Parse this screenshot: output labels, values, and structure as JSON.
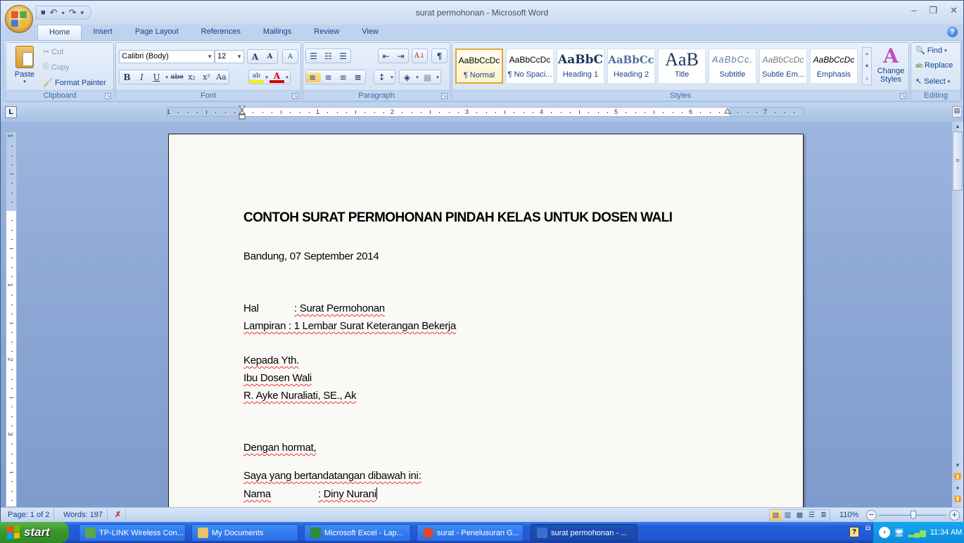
{
  "window": {
    "title": "surat permohonan - Microsoft Word",
    "controls": {
      "minimize": "–",
      "restore": "❐",
      "close": "✕"
    }
  },
  "quick_access": {
    "save": "💾",
    "undo": "↶",
    "redo": "↷",
    "customize": "▾"
  },
  "tabs": [
    {
      "label": "Home",
      "active": true
    },
    {
      "label": "Insert"
    },
    {
      "label": "Page Layout"
    },
    {
      "label": "References"
    },
    {
      "label": "Mailings"
    },
    {
      "label": "Review"
    },
    {
      "label": "View"
    }
  ],
  "help_icon": "?",
  "ribbon": {
    "clipboard": {
      "label": "Clipboard",
      "paste": "Paste",
      "cut": "Cut",
      "copy": "Copy",
      "format_painter": "Format Painter"
    },
    "font": {
      "label": "Font",
      "font_name": "Calibri (Body)",
      "font_size": "12",
      "grow": "A",
      "shrink": "A",
      "clear": "A",
      "bold": "B",
      "italic": "I",
      "underline": "U",
      "strike": "abe",
      "subscript": "x₂",
      "superscript": "x²",
      "change_case": "Aa",
      "highlight": "ab",
      "font_color": "A",
      "highlight_color": "#f5f000",
      "font_color_value": "#d40000"
    },
    "paragraph": {
      "label": "Paragraph",
      "bullets": "☰",
      "numbering": "☷",
      "multilevel": "☰",
      "decrease_indent": "⇤",
      "increase_indent": "⇥",
      "sort": "A↓",
      "show_marks": "¶",
      "align_left": "≡",
      "center": "≡",
      "align_right": "≡",
      "justify": "≡",
      "line_spacing": "↕",
      "shading": "◈",
      "borders": "▦"
    },
    "styles": {
      "label": "Styles",
      "items": [
        {
          "preview": "AaBbCcDc",
          "name": "¶ Normal",
          "selected": true
        },
        {
          "preview": "AaBbCcDc",
          "name": "¶ No Spaci..."
        },
        {
          "preview": "AaBbC",
          "name": "Heading 1"
        },
        {
          "preview": "AaBbCc",
          "name": "Heading 2"
        },
        {
          "preview": "AaB",
          "name": "Title"
        },
        {
          "preview": "AaBbCc.",
          "name": "Subtitle"
        },
        {
          "preview": "AaBbCcDc",
          "name": "Subtle Em..."
        },
        {
          "preview": "AaBbCcDc",
          "name": "Emphasis"
        }
      ],
      "change_styles": "Change Styles"
    },
    "editing": {
      "label": "Editing",
      "find": "Find",
      "replace": "Replace",
      "select": "Select"
    }
  },
  "ruler": {
    "tab_selector": "L",
    "h_labels": [
      "1",
      "1",
      "2",
      "3",
      "4",
      "5",
      "6",
      "7"
    ],
    "v_labels": [
      "1",
      "1",
      "2",
      "3"
    ]
  },
  "document": {
    "lines": [
      {
        "text": "CONTOH SURAT PERMOHONAN PINDAH KELAS UNTUK DOSEN WALI",
        "style": "heading"
      },
      {
        "text": "Bandung, 07 September 2014"
      },
      {
        "label": "Hal",
        "value": ": Surat Permohonan"
      },
      {
        "label": "Lampiran",
        "value": " : 1 Lembar Surat Keterangan Bekerja"
      },
      {
        "text": "Kepada Yth."
      },
      {
        "text": "Ibu Dosen Wali"
      },
      {
        "text": "R. Ayke Nuraliati, SE., Ak"
      },
      {
        "text": "Dengan hormat,"
      },
      {
        "text": "Saya yang bertandatangan dibawah ini:"
      },
      {
        "label": "Nama",
        "value": ": Diny Nurani"
      }
    ]
  },
  "statusbar": {
    "page": "Page: 1 of 2",
    "words": "Words: 197",
    "proofing_icon": "✗",
    "zoom": "110%",
    "zoom_out": "−",
    "zoom_in": "+",
    "zoom_level_percent": 110
  },
  "taskbar": {
    "start": "start",
    "tasks": [
      {
        "label": "TP-LINK Wireless Con...",
        "icon_color": "#5aa84a"
      },
      {
        "label": "My Documents",
        "icon_color": "#e6c36a"
      },
      {
        "label": "Microsoft Excel - Lap...",
        "icon_color": "#2e8b3c"
      },
      {
        "label": "surat - Penelusuran G...",
        "icon_color": "#e0462e"
      },
      {
        "label": "surat permohonan - ...",
        "icon_color": "#3a6fd0",
        "active": true
      }
    ],
    "clock": "11:34 AM"
  }
}
